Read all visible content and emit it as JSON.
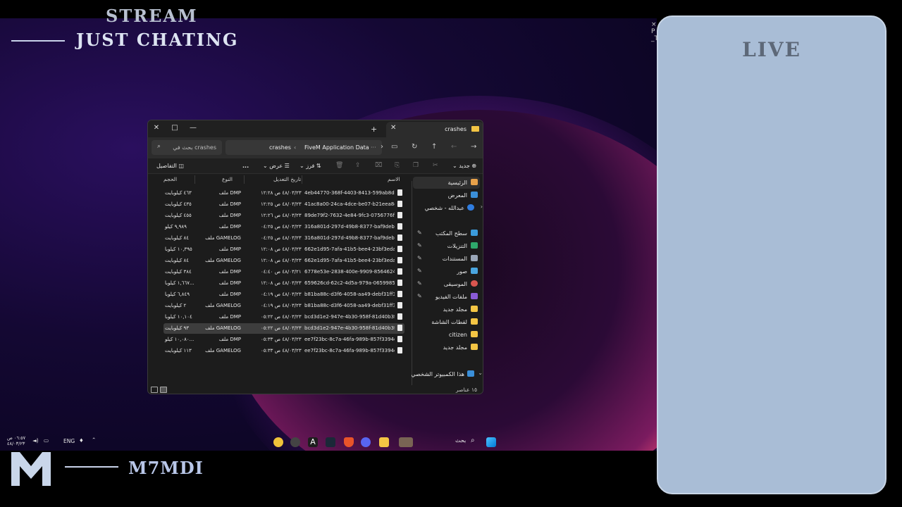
{
  "overlay": {
    "stream_label": "STREAM",
    "chat_label": "JUST CHATING",
    "live_label": "LIVE",
    "brand_name": "M7MDI"
  },
  "explorer": {
    "tab_title": "crashes",
    "path": [
      "FiveM Application Data",
      "crashes"
    ],
    "search_placeholder": "بحث في crashes",
    "commands": {
      "new": "جديد",
      "sort": "فرز",
      "view": "عرض",
      "more": "...",
      "details": "التفاصيل"
    },
    "columns": {
      "name": "الاسم",
      "date": "تاريخ التعديل",
      "type": "النوع",
      "size": "الحجم"
    },
    "files": [
      {
        "name": "4eb44770-368f-4403-8413-599ab8dd3d0a...",
        "date": "٤٨/٠٣/٢٣ ص ١٢:٢٨",
        "type": "ملف DMP",
        "size": "٤٦٣ كيلوبايت"
      },
      {
        "name": "41ac8a00-24ca-4dce-be07-b21eea8ddc6...",
        "date": "٤٨/٠٣/٢٣ ص ١٢:٢٥",
        "type": "ملف DMP",
        "size": "٤٣٥ كيلوبايت"
      },
      {
        "name": "89de79f2-7632-4e84-9fc3-0756776fa9e7...",
        "date": "٤٨/٠٣/٢٣ ص ١٢:٢٦",
        "type": "ملف DMP",
        "size": "٤٥٥ كيلوبايت"
      },
      {
        "name": "316a801d-297d-49b8-8377-baf9debba36e...",
        "date": "٤٨/٠٣/٢٣ ص ٠٤:٢٥",
        "type": "ملف DMP",
        "size": "٩,٩٨٩ كيلو"
      },
      {
        "name": "316a801d-297d-49b8-8377-baf9debba36e...",
        "date": "٤٨/٠٣/٢٣ ص ٠٤:٢٥",
        "type": "ملف GAMELOG",
        "size": "٨٤ كيلوبايت"
      },
      {
        "name": "662e1d95-7afa-41b5-bee4-23bf3eda1eb7...",
        "date": "٤٨/٠٣/٢٣ ص ١٢:٠٨",
        "type": "ملف DMP",
        "size": "١٠,٣٩٥ كيلوبا"
      },
      {
        "name": "662e1d95-7afa-41b5-bee4-23bf3eda1eb7...",
        "date": "٤٨/٠٣/٢٣ ص ١٢:٠٨",
        "type": "ملف GAMELOG",
        "size": "٨٤ كيلوبايت"
      },
      {
        "name": "6778e53e-2838-400e-9909-85646246823a...",
        "date": "٤٨/٠٣/٢١ ص ٠٤:٤٠",
        "type": "ملف DMP",
        "size": "٣٨٤ كيلوبايت"
      },
      {
        "name": "659626cd-62c2-4d5a-979a-065998520205...",
        "date": "٤٨/٠٣/٢٣ ص ١٢:٠٨",
        "type": "ملف DMP",
        "size": "١,٦٦٧ كيلوبا..."
      },
      {
        "name": "b81ba88c-d3f6-4058-aa49-debf31ff3c0d...",
        "date": "٤٨/٠٣/٢٣ ص ٠٤:١٩",
        "type": "ملف DMP",
        "size": "٦,٨٤٩ كيلوبا"
      },
      {
        "name": "b81ba88c-d3f6-4058-aa49-debf31ff3c0d...",
        "date": "٤٨/٠٣/٢٣ ص ٠٤:١٩",
        "type": "ملف GAMELOG",
        "size": "٢ كيلوبايت"
      },
      {
        "name": "bcd3d1e2-947e-4b30-958f-81d40b3fcdd4...",
        "date": "٤٨/٠٣/٢٣ ص ٠٥:٢٢",
        "type": "ملف DMP",
        "size": "١٠,١٠٤ كيلوبا"
      },
      {
        "name": "bcd3d1e2-947e-4b30-958f-81d40b3fcdd4...",
        "date": "٤٨/٠٣/٢٣ ص ٠٥:٢٢",
        "type": "ملف GAMELOG",
        "size": "٩٣ كيلوبايت"
      },
      {
        "name": "ee7f23bc-8c7a-46fa-989b-857f3394cf6c.d...",
        "date": "٤٨/٠٣/٢٣ ص ٠٥:٣٣",
        "type": "ملف DMP",
        "size": "١٠,٠٨٠ كيلو..."
      },
      {
        "name": "ee7f23bc-8c7a-46fa-989b-857f3394cf6c.d...",
        "date": "٤٨/٠٣/٢٣ ص ٠٥:٣٣",
        "type": "ملف GAMELOG",
        "size": "١١٣ كيلوبايت"
      }
    ],
    "selected_row": 12,
    "nav": {
      "home": "الرئيسية",
      "gallery": "المعرض",
      "onedrive": "عبدالله - شخصي",
      "desktop": "سطح المكتب",
      "downloads": "التنزيلات",
      "documents": "المستندات",
      "pictures": "صور",
      "music": "الموسيقى",
      "videos": "ملفات الفيديو",
      "new_folder_1": "مجلد جديد",
      "screenshots": "لقطات الشاشة",
      "citizen": "citizen",
      "new_folder_2": "مجلد جديد",
      "this_pc": "هذا الكمبيوتر الشخصي"
    },
    "status_count": "١٥ عناصر"
  },
  "taskbar": {
    "search_label": "بحث",
    "lang": "ENG",
    "time": "٠٦:٥٧ ص",
    "date": "٤٨/٠٣/٢٣"
  },
  "colors": {
    "accent_folder": "#f3c544",
    "live_panel": "#a9bdd6"
  }
}
